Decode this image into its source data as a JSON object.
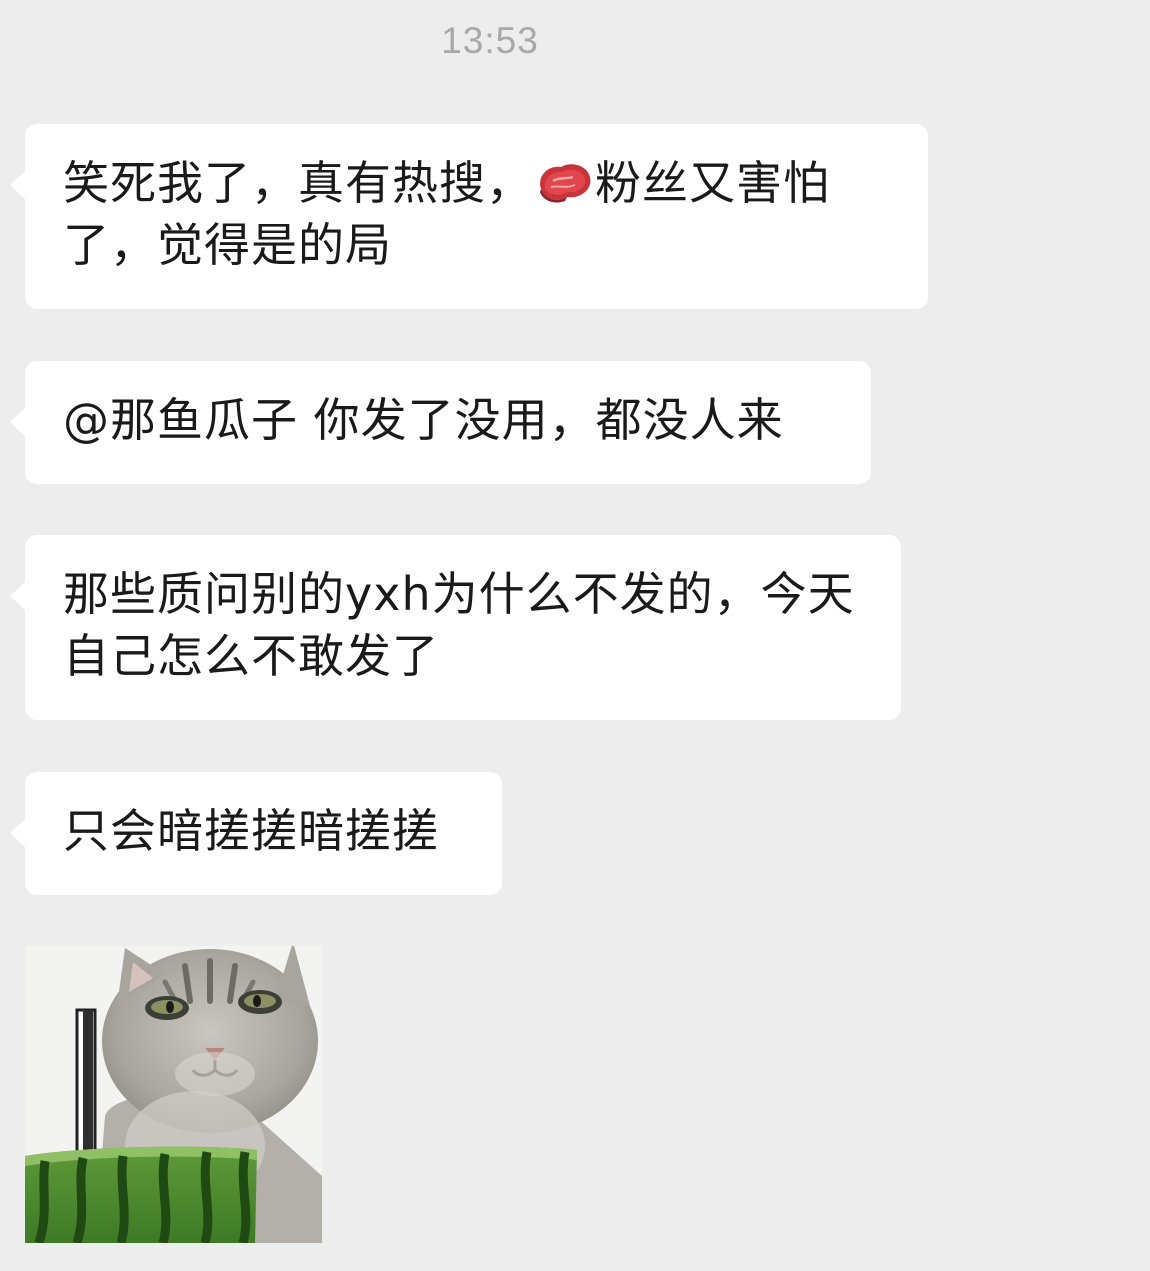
{
  "timestamp": "13:53",
  "messages": [
    {
      "part1": "笑死我了，真有热搜，",
      "icon": "meat-icon",
      "part2": "粉丝又害怕了，觉得是的局"
    },
    {
      "text": "@那鱼瓜子 你发了没用，都没人来"
    },
    {
      "text": "那些质问别的yxh为什么不发的，今天自己怎么不敢发了"
    },
    {
      "text": "只会暗搓搓暗搓搓"
    }
  ],
  "sticker": {
    "name": "cat-watermelon-sticker"
  },
  "colors": {
    "background": "#ededed",
    "bubble": "#ffffff",
    "timestamp": "#a8a8a8"
  }
}
